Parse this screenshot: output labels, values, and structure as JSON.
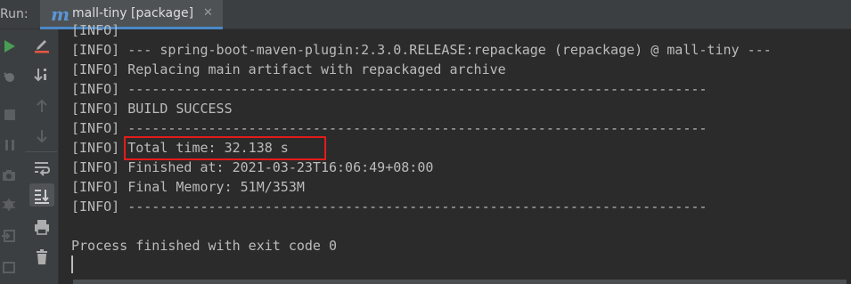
{
  "run_bar": {
    "label": "Run:",
    "tab_title": "mall-tiny [package]",
    "tab_icon_glyph": "m",
    "close_glyph": "✕"
  },
  "console": {
    "lines": [
      "[INFO]",
      "[INFO] --- spring-boot-maven-plugin:2.3.0.RELEASE:repackage (repackage) @ mall-tiny ---",
      "[INFO] Replacing main artifact with repackaged archive",
      "[INFO] ------------------------------------------------------------------------",
      "[INFO] BUILD SUCCESS",
      "[INFO] ------------------------------------------------------------------------",
      "[INFO] Total time: 32.138 s",
      "[INFO] Finished at: 2021-03-23T16:06:49+08:00",
      "[INFO] Final Memory: 51M/353M",
      "[INFO] ------------------------------------------------------------------------",
      "",
      "Process finished with exit code 0"
    ]
  },
  "colors": {
    "background": "#2b2b2b",
    "toolbar": "#3c3f41",
    "text": "#bbbbbb",
    "highlight_box": "#e31b1b",
    "run_green": "#499c54",
    "accent_blue": "#4a88c7"
  }
}
